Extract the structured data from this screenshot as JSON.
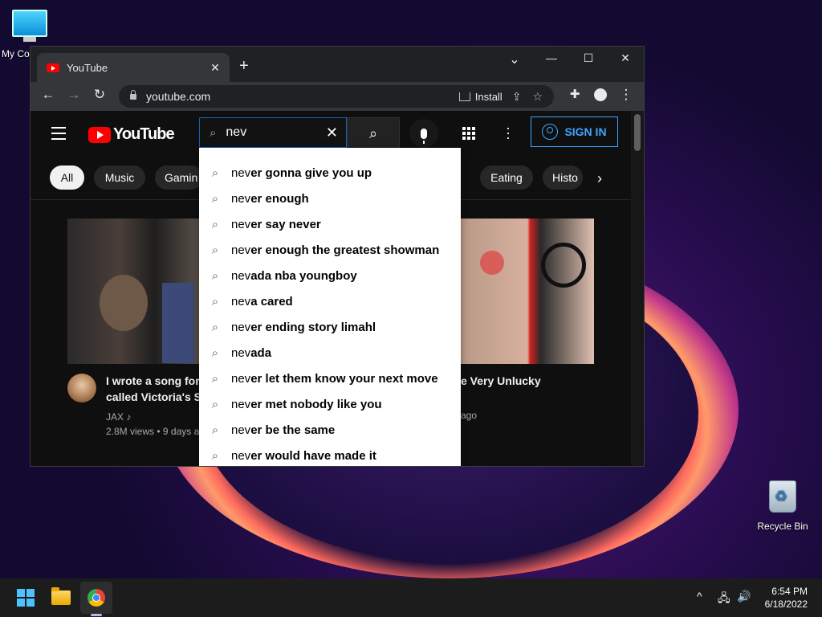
{
  "desktop": {
    "icons": [
      {
        "label": "My Co"
      },
      {
        "label": "Recycle Bin"
      }
    ]
  },
  "browser": {
    "tab_title": "YouTube",
    "tab_close": "✕",
    "new_tab": "+",
    "window_controls": {
      "dropdown": "⌄",
      "minimize": "—",
      "maximize": "☐",
      "close": "✕"
    },
    "nav": {
      "back": "←",
      "forward": "→",
      "reload": "↻"
    },
    "url": "youtube.com",
    "install_label": "Install",
    "toolbar_icons": [
      "share-icon",
      "star-icon",
      "extensions-icon",
      "profile-icon",
      "menu-icon"
    ]
  },
  "youtube": {
    "logo_text": "YouTube",
    "search": {
      "value": "nev",
      "clear": "✕"
    },
    "signin_label": "SIGN IN",
    "chips": [
      {
        "label": "All",
        "active": true
      },
      {
        "label": "Music"
      },
      {
        "label": "Gamin"
      },
      {
        "label": "Eating"
      },
      {
        "label": "Histo"
      }
    ],
    "suggestions": [
      {
        "typed": "nev",
        "rest": "er gonna give you up"
      },
      {
        "typed": "nev",
        "rest": "er enough"
      },
      {
        "typed": "nev",
        "rest": "er say never"
      },
      {
        "typed": "nev",
        "rest": "er enough the greatest showman"
      },
      {
        "typed": "nev",
        "rest": "ada nba youngboy"
      },
      {
        "typed": "nev",
        "rest": "a cared"
      },
      {
        "typed": "nev",
        "rest": "er ending story limahl"
      },
      {
        "typed": "nev",
        "rest": "ada"
      },
      {
        "typed": "nev",
        "rest": "er let them know your next move"
      },
      {
        "typed": "nev",
        "rest": "er met nobody like you"
      },
      {
        "typed": "nev",
        "rest": "er be the same"
      },
      {
        "typed": "nev",
        "rest": "er would have made it"
      }
    ],
    "videos": [
      {
        "title_line1": "I wrote a song for T",
        "title_line2": "called Victoria's Se",
        "channel": "JAX ♪",
        "meta": "2.8M views • 9 days a"
      },
      {
        "title_line1": "e Very Unlucky",
        "meta": "ago"
      }
    ]
  },
  "taskbar": {
    "time": "6:54 PM",
    "date": "6/18/2022",
    "tray": {
      "chevron": "^",
      "network": "🖧",
      "volume": "🔊"
    }
  }
}
